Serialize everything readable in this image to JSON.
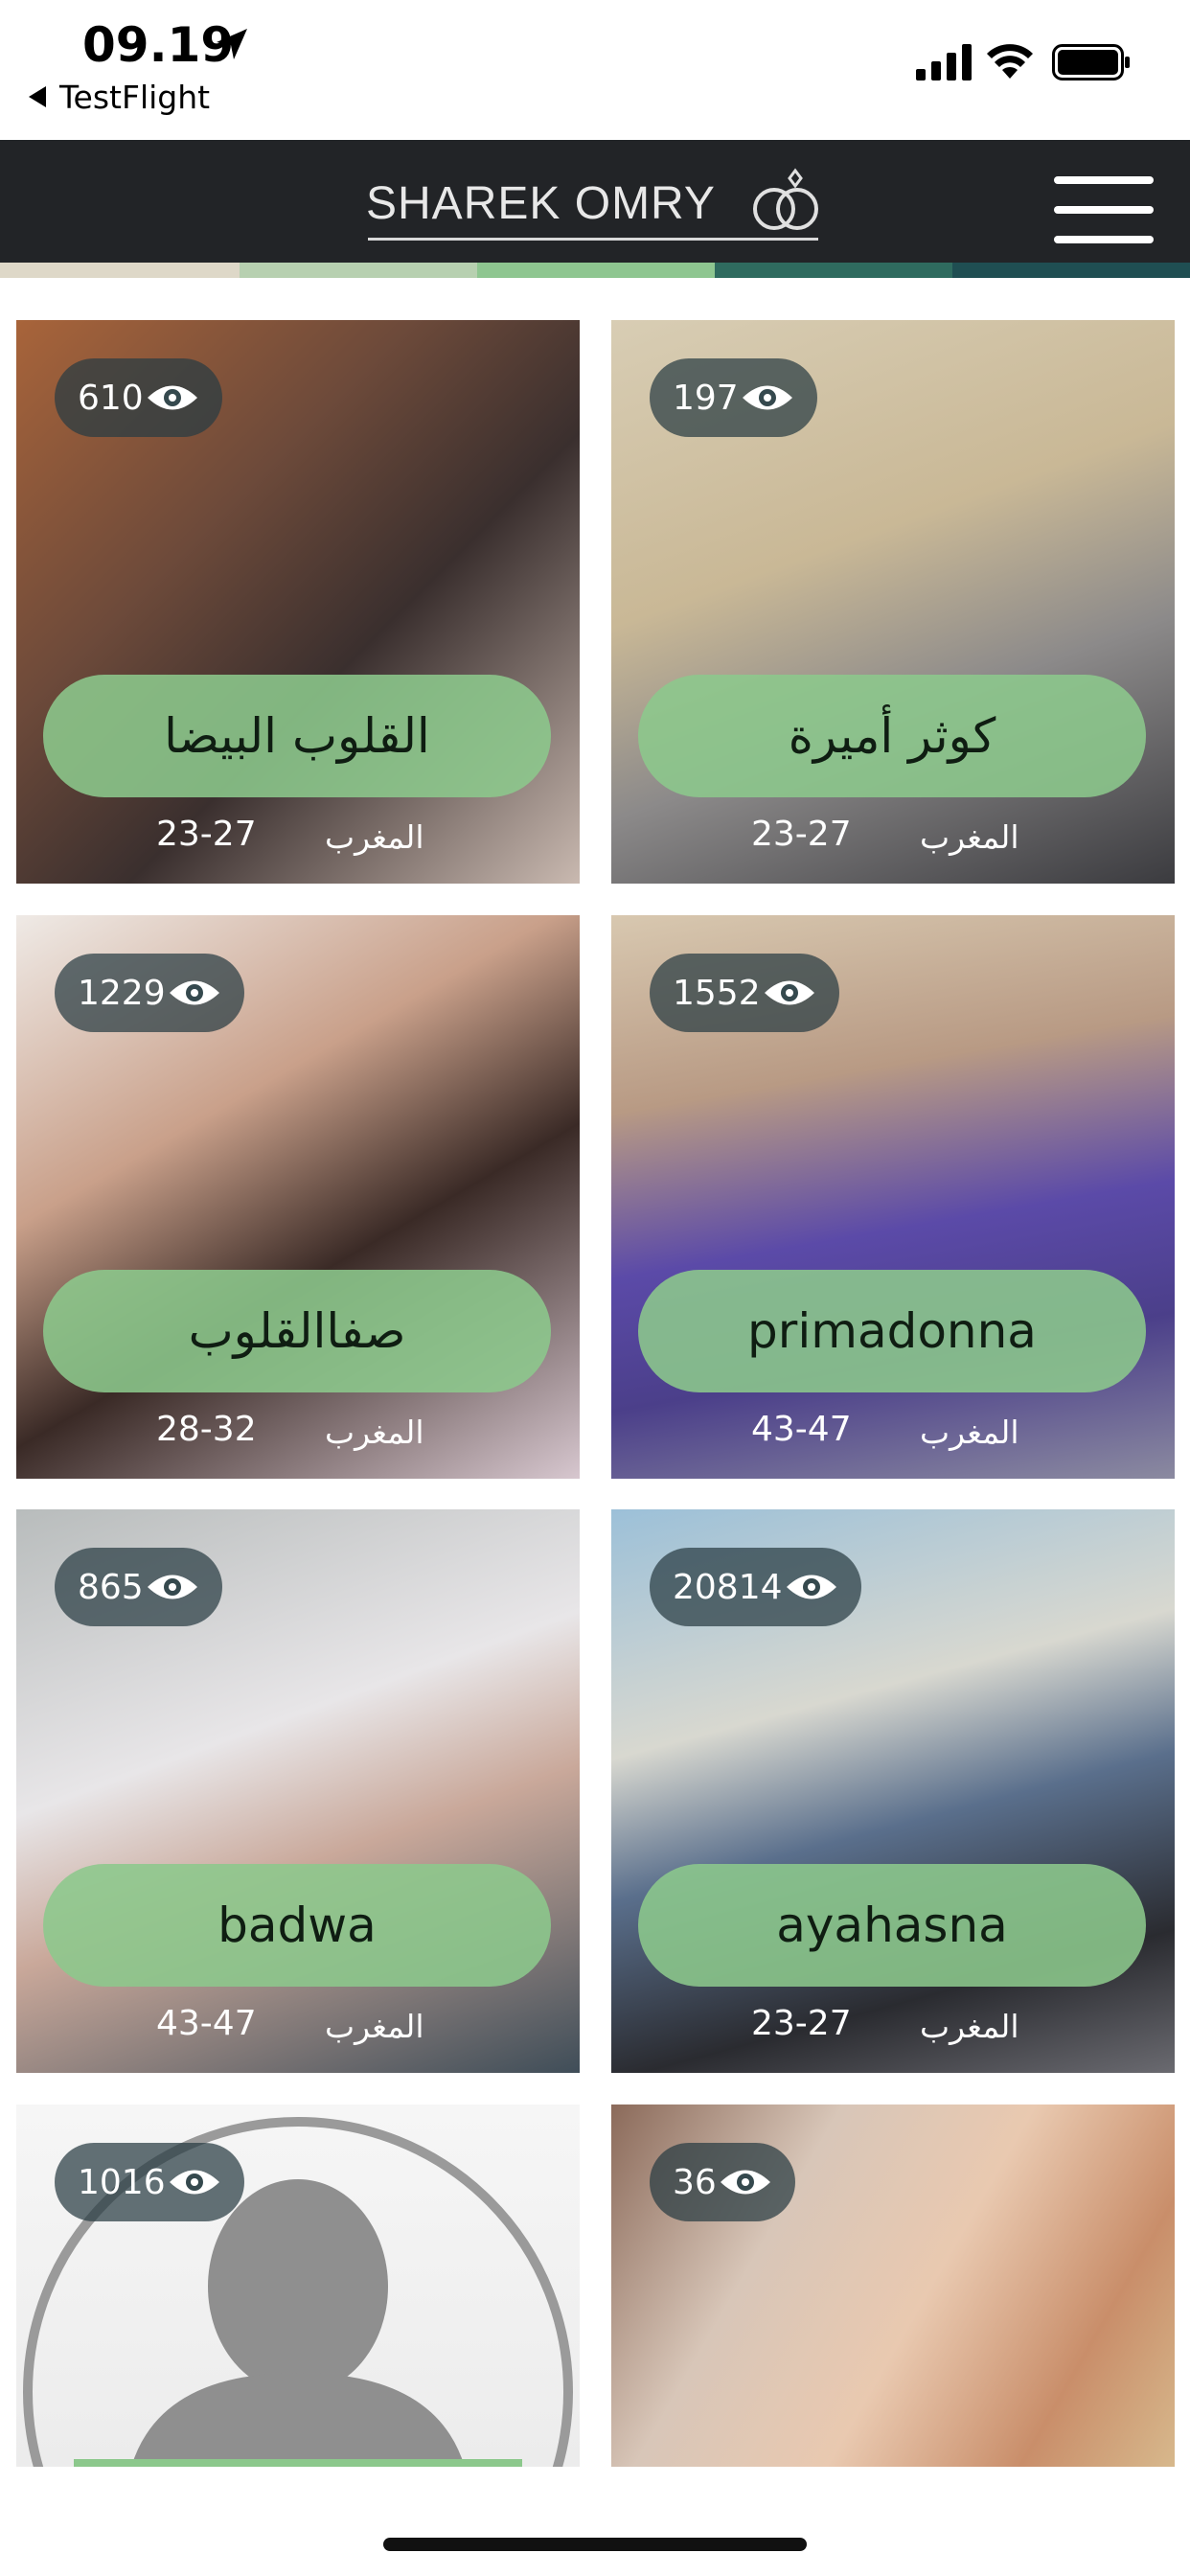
{
  "status_bar": {
    "time": "09.19",
    "back_label": "TestFlight"
  },
  "header": {
    "logo_text": "SHAREK OMRY",
    "menu_icon": "hamburger-menu-icon",
    "stripe_colors": [
      "#ded8c8",
      "#b7d0b0",
      "#8ec690",
      "#2f6b5f",
      "#1f4e52"
    ]
  },
  "profiles": [
    {
      "views": "610",
      "name": "القلوب البيضا",
      "country": "المغرب",
      "age": "23-27"
    },
    {
      "views": "197",
      "name": "كوثر أميرة",
      "country": "المغرب",
      "age": "23-27"
    },
    {
      "views": "1229",
      "name": "صفاالقلوب",
      "country": "المغرب",
      "age": "28-32"
    },
    {
      "views": "1552",
      "name": "primadonna",
      "country": "المغرب",
      "age": "43-47"
    },
    {
      "views": "865",
      "name": "badwa",
      "country": "المغرب",
      "age": "43-47"
    },
    {
      "views": "20814",
      "name": "ayahasna",
      "country": "المغرب",
      "age": "23-27"
    },
    {
      "views": "1016"
    },
    {
      "views": "36"
    }
  ]
}
